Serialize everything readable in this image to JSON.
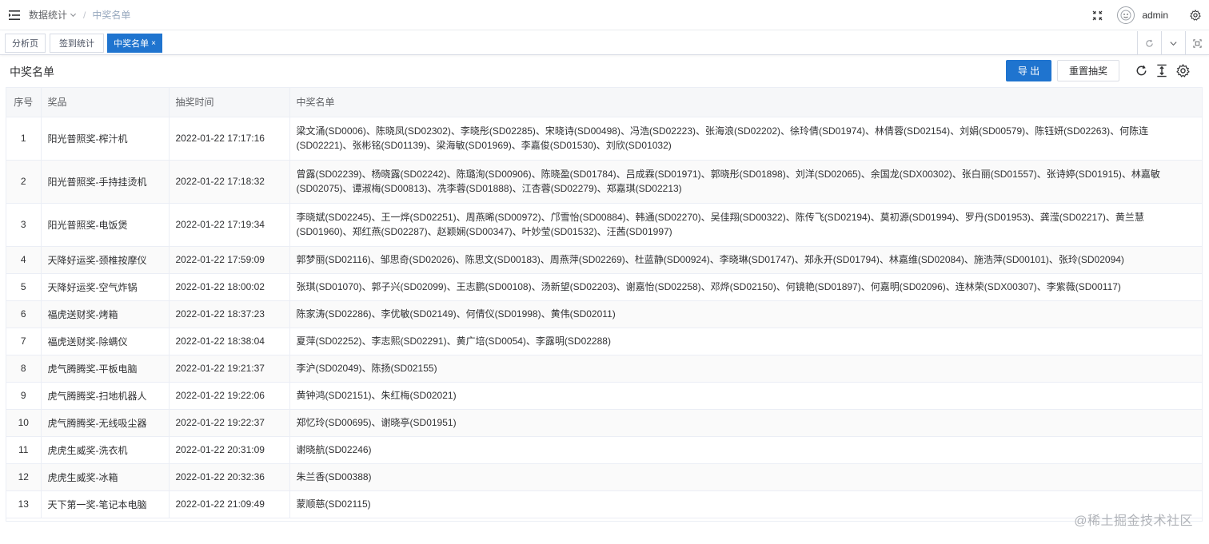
{
  "breadcrumb": {
    "items": [
      "数据统计",
      "中奖名单"
    ]
  },
  "user": {
    "name": "admin"
  },
  "tags": [
    {
      "label": "分析页",
      "active": false
    },
    {
      "label": "签到统计",
      "active": false
    },
    {
      "label": "中奖名单",
      "active": true,
      "close": "×"
    }
  ],
  "panel": {
    "title": "中奖名单",
    "export_label": "导 出",
    "reset_label": "重置抽奖"
  },
  "table": {
    "headers": [
      "序号",
      "奖品",
      "抽奖时间",
      "中奖名单"
    ],
    "rows": [
      {
        "no": "1",
        "prize": "阳光普照奖-榨汁机",
        "time": "2022-01-22 17:17:16",
        "winners": "梁文涌(SD0006)、陈晓凤(SD02302)、李晓彤(SD02285)、宋晓诗(SD00498)、冯浩(SD02223)、张海浪(SD02202)、徐玲倩(SD01974)、林倩蓉(SD02154)、刘娟(SD00579)、陈钰妍(SD02263)、何陈连(SD02221)、张彬铭(SD01139)、梁海敏(SD01969)、李嘉俊(SD01530)、刘欣(SD01032)"
      },
      {
        "no": "2",
        "prize": "阳光普照奖-手持挂烫机",
        "time": "2022-01-22 17:18:32",
        "winners": "曾露(SD02239)、杨晓露(SD02242)、陈璐洵(SD00906)、陈晓盈(SD01784)、吕成霖(SD01971)、郭晓彤(SD01898)、刘洋(SD02065)、余国龙(SDX00302)、张白丽(SD01557)、张诗婷(SD01915)、林嘉敏(SD02075)、谭淑梅(SD00813)、冼李蓉(SD01888)、江杏蓉(SD02279)、郑嘉琪(SD02213)"
      },
      {
        "no": "3",
        "prize": "阳光普照奖-电饭煲",
        "time": "2022-01-22 17:19:34",
        "winners": "李晓斌(SD02245)、王一烨(SD02251)、周燕晞(SD00972)、邝雪怡(SD00884)、韩通(SD02270)、吴佳翔(SD00322)、陈传飞(SD02194)、莫初源(SD01994)、罗丹(SD01953)、龚滢(SD02217)、黄兰慧(SD01960)、郑红燕(SD02287)、赵颖娴(SD00347)、叶妙莹(SD01532)、汪茜(SD01997)"
      },
      {
        "no": "4",
        "prize": "天降好运奖-颈椎按摩仪",
        "time": "2022-01-22 17:59:09",
        "winners": "郭梦丽(SD02116)、邹思奇(SD02026)、陈思文(SD00183)、周燕萍(SD02269)、杜蓝静(SD00924)、李晓琳(SD01747)、郑永开(SD01794)、林嘉维(SD02084)、施浩萍(SD00101)、张玲(SD02094)"
      },
      {
        "no": "5",
        "prize": "天降好运奖-空气炸锅",
        "time": "2022-01-22 18:00:02",
        "winners": "张琪(SD01070)、郭子兴(SD02099)、王志鹏(SD00108)、汤新望(SD02203)、谢嘉怡(SD02258)、邓烨(SD02150)、何镜艳(SD01897)、何嘉明(SD02096)、连林荣(SDX00307)、李紫薇(SD00117)"
      },
      {
        "no": "6",
        "prize": "福虎送财奖-烤箱",
        "time": "2022-01-22 18:37:23",
        "winners": "陈家涛(SD02286)、李优敏(SD02149)、何倩仪(SD01998)、黄伟(SD02011)"
      },
      {
        "no": "7",
        "prize": "福虎送财奖-除螨仪",
        "time": "2022-01-22 18:38:04",
        "winners": "夏萍(SD02252)、李志熙(SD02291)、黄广培(SD0054)、李露明(SD02288)"
      },
      {
        "no": "8",
        "prize": "虎气腾腾奖-平板电脑",
        "time": "2022-01-22 19:21:37",
        "winners": "李沪(SD02049)、陈扬(SD02155)"
      },
      {
        "no": "9",
        "prize": "虎气腾腾奖-扫地机器人",
        "time": "2022-01-22 19:22:06",
        "winners": "黄钟鸿(SD02151)、朱红梅(SD02021)"
      },
      {
        "no": "10",
        "prize": "虎气腾腾奖-无线吸尘器",
        "time": "2022-01-22 19:22:37",
        "winners": "郑忆玲(SD00695)、谢晓亭(SD01951)"
      },
      {
        "no": "11",
        "prize": "虎虎生威奖-洗衣机",
        "time": "2022-01-22 20:31:09",
        "winners": "谢晓航(SD02246)"
      },
      {
        "no": "12",
        "prize": "虎虎生威奖-冰箱",
        "time": "2022-01-22 20:32:36",
        "winners": "朱兰香(SD00388)"
      },
      {
        "no": "13",
        "prize": "天下第一奖-笔记本电脑",
        "time": "2022-01-22 21:09:49",
        "winners": "蒙顺慈(SD02115)"
      }
    ]
  },
  "watermark": "@稀土掘金技术社区",
  "icons": {
    "menu": "hamburger-icon",
    "fullscreen": "fullscreen-icon",
    "settings": "gear-icon",
    "refresh": "refresh-icon",
    "column": "column-height-icon"
  },
  "colors": {
    "primary": "#1f74cf",
    "header_bg": "#f6f7f9",
    "stripe": "#fafafa"
  }
}
